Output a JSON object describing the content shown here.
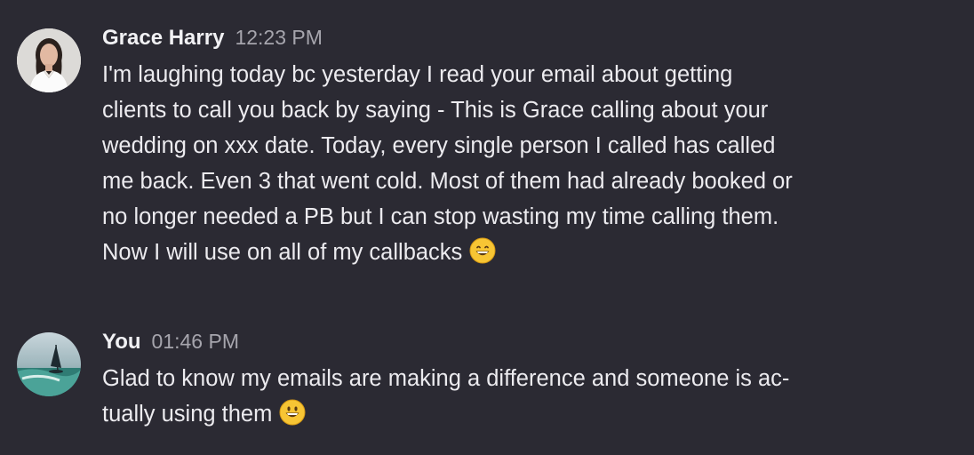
{
  "messages": [
    {
      "author": "Grace Harry",
      "time": "12:23 PM",
      "lines": [
        "I'm laughing today bc yesterday I read your email about getting",
        "clients to call you back by saying - This is Grace calling about your",
        "wedding on xxx date.  Today, every single person I called has called",
        "me back. Even 3 that went cold.  Most of them had already booked or",
        "no longer needed a PB but I can stop wasting my time calling them.",
        "Now I will use on all of my callbacks"
      ],
      "emoji": "grinning-face-icon"
    },
    {
      "author": "You",
      "time": "01:46 PM",
      "lines": [
        "Glad to know my emails are making a difference and someone is ac-",
        "tually using them"
      ],
      "emoji": "grinning-face-icon"
    }
  ],
  "colors": {
    "background": "#2b2a33",
    "text": "#ecebef",
    "timestamp": "#a6a5ad",
    "emoji": "#f7c534"
  }
}
